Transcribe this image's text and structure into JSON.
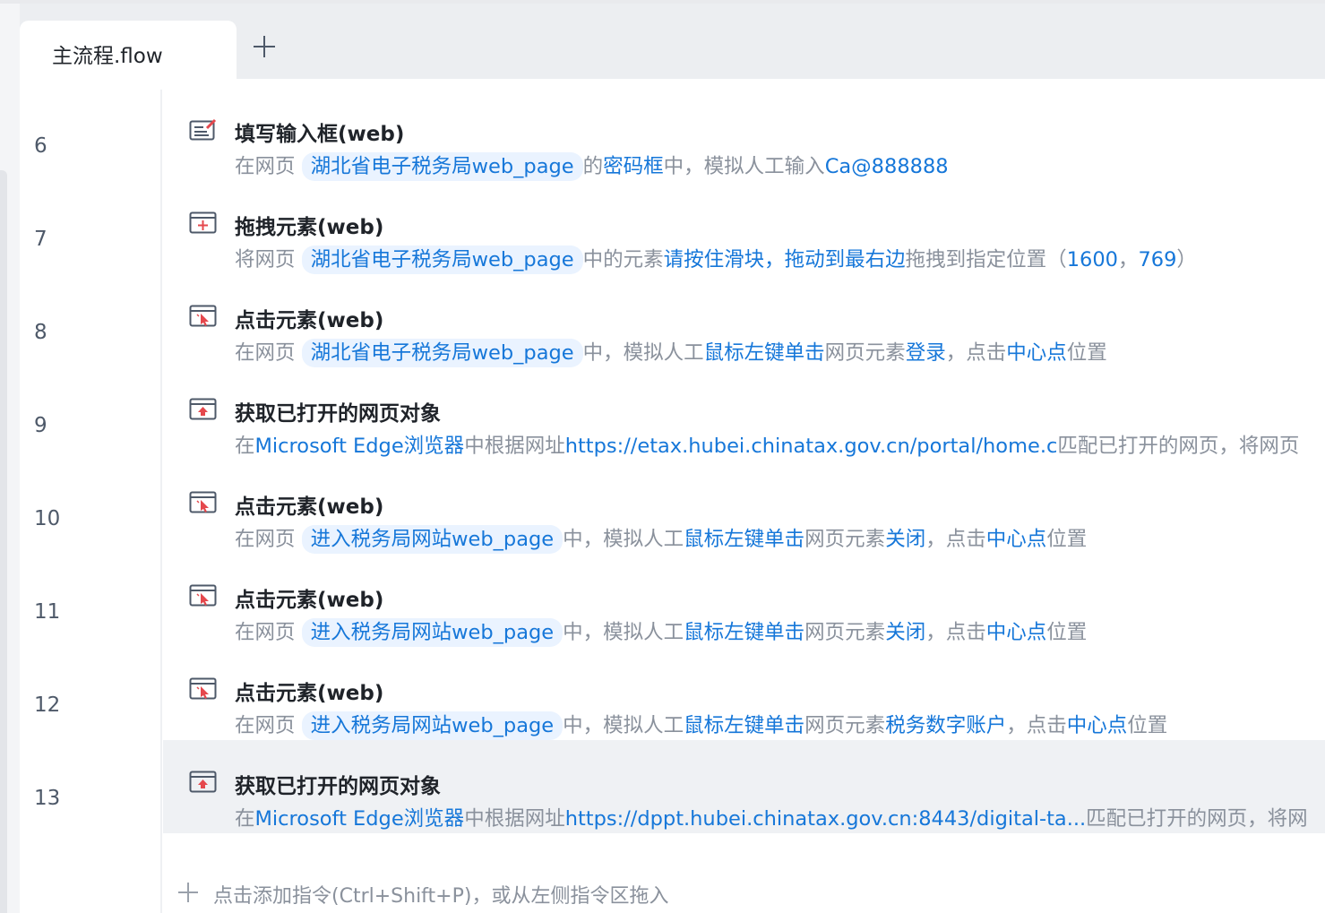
{
  "tabs": [
    {
      "label": "主流程.flow"
    }
  ],
  "line_numbers": [
    "6",
    "7",
    "8",
    "9",
    "10",
    "11",
    "12",
    "13"
  ],
  "rows": [
    {
      "title": "填写输入框(web)",
      "icon": "fill-input-icon",
      "desc": [
        {
          "t": "在网页 "
        },
        {
          "t": "湖北省电子税务局web_page",
          "chip": true
        },
        {
          "t": "的"
        },
        {
          "t": "密码框",
          "hl": true
        },
        {
          "t": "中，模拟人工输入"
        },
        {
          "t": "Ca@888888",
          "hl": true
        }
      ]
    },
    {
      "title": "拖拽元素(web)",
      "icon": "drag-element-icon",
      "desc": [
        {
          "t": "将网页 "
        },
        {
          "t": "湖北省电子税务局web_page",
          "chip": true
        },
        {
          "t": "中的元素"
        },
        {
          "t": "请按住滑块，拖动到最右边",
          "hl": true
        },
        {
          "t": "拖拽到指定位置（"
        },
        {
          "t": "1600",
          "hl": true
        },
        {
          "t": "，"
        },
        {
          "t": "769",
          "hl": true
        },
        {
          "t": "）"
        }
      ]
    },
    {
      "title": "点击元素(web)",
      "icon": "click-element-icon",
      "desc": [
        {
          "t": "在网页 "
        },
        {
          "t": "湖北省电子税务局web_page",
          "chip": true
        },
        {
          "t": "中，模拟人工"
        },
        {
          "t": "鼠标左键单击",
          "hl": true
        },
        {
          "t": "网页元素"
        },
        {
          "t": "登录",
          "hl": true
        },
        {
          "t": "，点击"
        },
        {
          "t": "中心点",
          "hl": true
        },
        {
          "t": "位置"
        }
      ]
    },
    {
      "title": "获取已打开的网页对象",
      "icon": "get-webpage-icon",
      "desc": [
        {
          "t": "在"
        },
        {
          "t": "Microsoft Edge浏览器",
          "hl": true
        },
        {
          "t": "中根据网址"
        },
        {
          "t": "https://etax.hubei.chinatax.gov.cn/portal/home.c",
          "hl": true
        },
        {
          "t": "匹配已打开的网页，将网页"
        }
      ]
    },
    {
      "title": "点击元素(web)",
      "icon": "click-element-icon",
      "desc": [
        {
          "t": "在网页 "
        },
        {
          "t": "进入税务局网站web_page",
          "chip": true
        },
        {
          "t": "中，模拟人工"
        },
        {
          "t": "鼠标左键单击",
          "hl": true
        },
        {
          "t": "网页元素"
        },
        {
          "t": "关闭",
          "hl": true
        },
        {
          "t": "，点击"
        },
        {
          "t": "中心点",
          "hl": true
        },
        {
          "t": "位置"
        }
      ]
    },
    {
      "title": "点击元素(web)",
      "icon": "click-element-icon",
      "desc": [
        {
          "t": "在网页 "
        },
        {
          "t": "进入税务局网站web_page",
          "chip": true
        },
        {
          "t": "中，模拟人工"
        },
        {
          "t": "鼠标左键单击",
          "hl": true
        },
        {
          "t": "网页元素"
        },
        {
          "t": "关闭",
          "hl": true
        },
        {
          "t": "，点击"
        },
        {
          "t": "中心点",
          "hl": true
        },
        {
          "t": "位置"
        }
      ]
    },
    {
      "title": "点击元素(web)",
      "icon": "click-element-icon",
      "desc": [
        {
          "t": "在网页 "
        },
        {
          "t": "进入税务局网站web_page",
          "chip": true
        },
        {
          "t": "中，模拟人工"
        },
        {
          "t": "鼠标左键单击",
          "hl": true
        },
        {
          "t": "网页元素"
        },
        {
          "t": "税务数字账户",
          "hl": true
        },
        {
          "t": "，点击"
        },
        {
          "t": "中心点",
          "hl": true
        },
        {
          "t": "位置"
        }
      ]
    },
    {
      "title": "获取已打开的网页对象",
      "icon": "get-webpage-icon",
      "active": true,
      "desc": [
        {
          "t": "在"
        },
        {
          "t": "Microsoft Edge浏览器",
          "hl": true
        },
        {
          "t": "中根据网址"
        },
        {
          "t": "https://dppt.hubei.chinatax.gov.cn:8443/digital-ta...",
          "hl": true
        },
        {
          "t": "匹配已打开的网页，将网"
        }
      ]
    }
  ],
  "footer": {
    "add_label": "点击添加指令(Ctrl+Shift+P)，或从左侧指令区拖入"
  },
  "colors": {
    "accent": "#1677d9",
    "icon_red": "#e5484d",
    "muted": "#8a919c"
  }
}
